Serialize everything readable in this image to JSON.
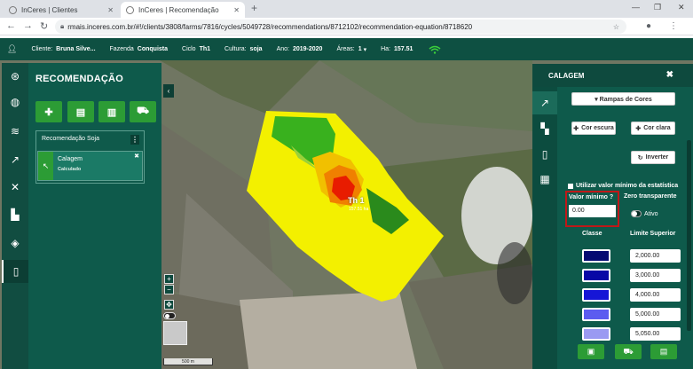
{
  "browser": {
    "tab1_title": "InCeres | Clientes",
    "tab2_title": "InCeres | Recomendação",
    "close_glyph": "✕",
    "new_tab": "+",
    "url": "rmais.inceres.com.br/#!/clients/3808/farms/7816/cycles/5049728/recommendations/8712102/recommendation-equation/8718620",
    "window_controls": [
      "—",
      "❐",
      "✕"
    ]
  },
  "appbar": {
    "cliente_label": "Cliente:",
    "cliente_value": "Bruna Silve...",
    "fazenda_label": "Fazenda",
    "fazenda_value": "Conquista",
    "ciclo_label": "Ciclo",
    "ciclo_value": "Th1",
    "cultura_label": "Cultura:",
    "cultura_value": "soja",
    "ano_label": "Ano:",
    "ano_value": "2019-2020",
    "areas_label": "Áreas:",
    "areas_value": "1",
    "ha_label": "Ha:",
    "ha_value": "157.51"
  },
  "left_panel": {
    "title": "RECOMENDAÇÃO",
    "card_title": "Recomendação Soja",
    "menu_glyph": "⋮",
    "item_name": "Calagem",
    "item_status": "Calculado"
  },
  "map": {
    "field_label": "Th 1",
    "field_sub": "157.51 ha",
    "scale_label": "500 m"
  },
  "right_panel": {
    "title": "CALAGEM",
    "ramps_button": "▾ Rampas de Cores",
    "dark_button": "Cor escura",
    "light_button": "Cor clara",
    "invert_button": "Inverter",
    "use_min_label": "Utilizar valor mínimo da estatística",
    "min_label": "Valor mínimo",
    "min_value": "0.00",
    "zero_label": "Zero transparente",
    "ativo_label": "Ativo",
    "classe_header": "Classe",
    "limit_header": "Limite Superior",
    "classes": [
      {
        "color": "#050a72",
        "limit": "2,000.00"
      },
      {
        "color": "#0808a6",
        "limit": "3,000.00"
      },
      {
        "color": "#1616d6",
        "limit": "4,000.00"
      },
      {
        "color": "#5c5cf0",
        "limit": "5,000.00"
      },
      {
        "color": "#9a9af2",
        "limit": "5,050.00"
      }
    ]
  }
}
